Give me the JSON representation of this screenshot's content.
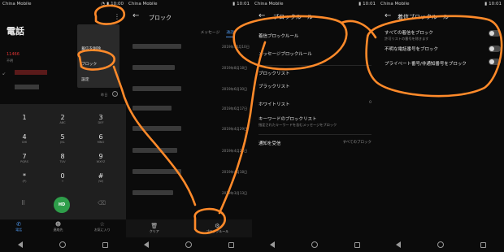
{
  "statusbar": {
    "carrier": "China Mobile",
    "times": [
      "10:00",
      "10:01",
      "10:01",
      "10:01"
    ]
  },
  "dialer": {
    "title": "電話",
    "menu_items": [
      "",
      "着信を削除",
      "ブロック",
      "設定"
    ],
    "call_entry_number": "11466",
    "call_entry_status": "不明",
    "yesterday": "昨日",
    "keys": [
      {
        "d": "1",
        "s": ""
      },
      {
        "d": "2",
        "s": "ABC"
      },
      {
        "d": "3",
        "s": "DEF"
      },
      {
        "d": "4",
        "s": "GHI"
      },
      {
        "d": "5",
        "s": "JKL"
      },
      {
        "d": "6",
        "s": "MNO"
      },
      {
        "d": "7",
        "s": "PQRS"
      },
      {
        "d": "8",
        "s": "TUV"
      },
      {
        "d": "9",
        "s": "WXYZ"
      },
      {
        "d": "*",
        "s": "(P)"
      },
      {
        "d": "0",
        "s": "+"
      },
      {
        "d": "#",
        "s": "(W)"
      }
    ],
    "call_badge": "HD",
    "nav": [
      "電話",
      "連絡先",
      "お気に入り"
    ]
  },
  "block_list": {
    "title": "ブロック",
    "tabs": [
      "メッセージ",
      "通話"
    ],
    "dates": [
      "2019年10月10日",
      "2019年8月18日",
      "2019年6月30日",
      "2019年6月17日",
      "2019年4月29日",
      "2019年4月24日",
      "2019年4月18日",
      "2019年3月13日"
    ],
    "bottom": [
      "クリア",
      "ブロックルール"
    ]
  },
  "block_rules": {
    "title": "ブロックルール",
    "items": [
      {
        "label": "着信ブロックルール",
        "sub": "",
        "val": ""
      },
      {
        "label": "メッセージブロックルール",
        "sub": "",
        "val": ""
      },
      {
        "label": "ブロックリスト",
        "sub": "",
        "val": ""
      },
      {
        "label": "ブラックリスト",
        "sub": "",
        "val": ""
      },
      {
        "label": "ホワイトリスト",
        "sub": "",
        "val": "0"
      },
      {
        "label": "キーワードのブロックリスト",
        "sub": "指定されたキーワードを含むメッセージをブロック",
        "val": ""
      },
      {
        "label": "通知を受信",
        "sub": "",
        "val": "すべてのブロック"
      }
    ]
  },
  "call_rules": {
    "title": "着信ブロックルール",
    "items": [
      {
        "label": "すべての着信をブロック",
        "sub": "許可リストの番号を除きます"
      },
      {
        "label": "不明な電話番号をブロック",
        "sub": ""
      },
      {
        "label": "プライベート番号/非通知番号をブロック",
        "sub": ""
      }
    ]
  }
}
